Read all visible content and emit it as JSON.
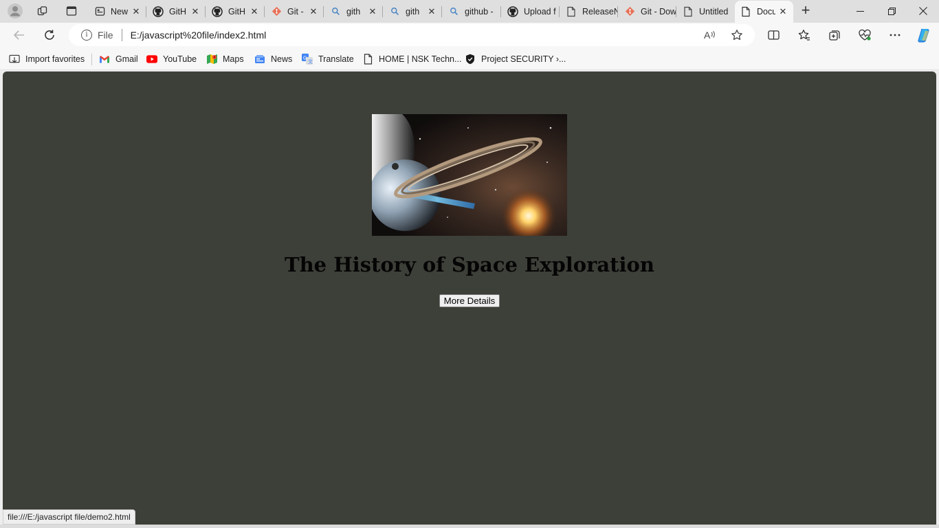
{
  "browser": {
    "tabs": [
      {
        "title": "New",
        "icon": "newtab-page-icon",
        "active": false
      },
      {
        "title": "GitH",
        "icon": "github-icon",
        "active": false
      },
      {
        "title": "GitH",
        "icon": "github-icon",
        "active": false
      },
      {
        "title": "Git -",
        "icon": "git-icon",
        "active": false
      },
      {
        "title": "gith",
        "icon": "search-icon",
        "active": false
      },
      {
        "title": "gith",
        "icon": "search-icon",
        "active": false
      },
      {
        "title": "github -",
        "icon": "search-icon",
        "active": false
      },
      {
        "title": "Upload f",
        "icon": "github-icon",
        "active": false
      },
      {
        "title": "ReleaseN",
        "icon": "document-icon",
        "active": false
      },
      {
        "title": "Git - Dow",
        "icon": "git-icon",
        "active": false
      },
      {
        "title": "Untitled",
        "icon": "document-icon",
        "active": false
      },
      {
        "title": "Docu",
        "icon": "document-icon",
        "active": true
      }
    ],
    "tab_close_glyph": "✕",
    "new_tab_glyph": "+",
    "address": {
      "scheme_label": "File",
      "url": "E:/javascript%20file/index2.html"
    },
    "favorites": [
      {
        "label": "Import favorites",
        "icon": "import-favorites-icon"
      },
      {
        "label": "Gmail",
        "icon": "gmail-icon"
      },
      {
        "label": "YouTube",
        "icon": "youtube-icon"
      },
      {
        "label": "Maps",
        "icon": "maps-icon"
      },
      {
        "label": "News",
        "icon": "news-icon"
      },
      {
        "label": "Translate",
        "icon": "translate-icon"
      },
      {
        "label": "HOME | NSK Techn...",
        "icon": "document-icon"
      },
      {
        "label": "Project SECURITY ›...",
        "icon": "shield-icon"
      }
    ],
    "status_url": "file:///E:/javascript file/demo2.html"
  },
  "page": {
    "heading": "The History of Space Exploration",
    "button_label": "More Details",
    "background_color": "#3d3f39"
  }
}
